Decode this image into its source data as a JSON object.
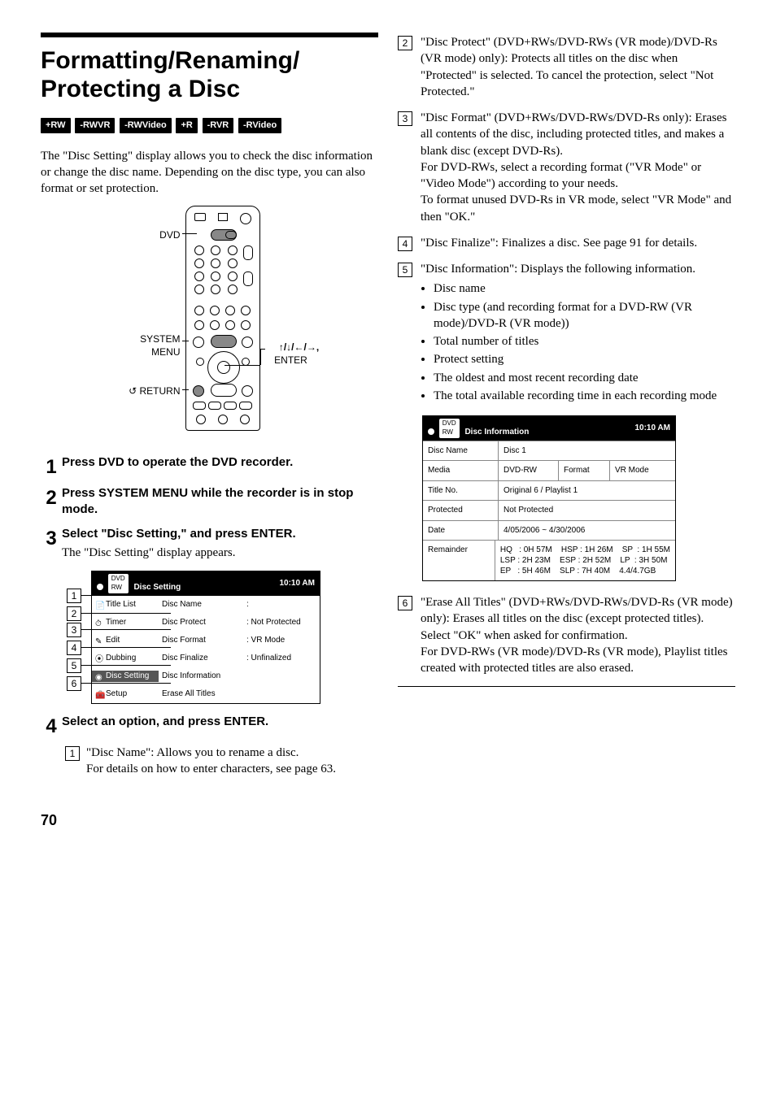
{
  "page_number": "70",
  "heading": "Formatting/Renaming/\nProtecting a Disc",
  "disc_tags": [
    "+RW",
    "-RWVR",
    "-RWVideo",
    "+R",
    "-RVR",
    "-RVideo"
  ],
  "intro": "The \"Disc Setting\" display allows you to check the disc information or change the disc name. Depending on the disc type, you can also format or set protection.",
  "remote": {
    "dvd": "DVD",
    "system_menu": "SYSTEM\nMENU",
    "return": "RETURN",
    "enter": "ENTER",
    "arrows": "↑/↓/←/→,"
  },
  "steps": {
    "s1": "Press DVD to operate the DVD recorder.",
    "s2": "Press SYSTEM MENU while the recorder is in stop mode.",
    "s3": "Select \"Disc Setting,\" and press ENTER.",
    "s3_sub": "The \"Disc Setting\" display appears.",
    "s4": "Select an option, and press ENTER."
  },
  "disc_setting_panel": {
    "title": "Disc Setting",
    "time": "10:10 AM",
    "sidebar": [
      "Title List",
      "Timer",
      "Edit",
      "Dubbing",
      "Disc Setting",
      "Setup"
    ],
    "rows": [
      {
        "name": "Disc Name",
        "val": ":"
      },
      {
        "name": "Disc Protect",
        "val": ":  Not Protected"
      },
      {
        "name": "Disc Format",
        "val": ":  VR Mode"
      },
      {
        "name": "Disc Finalize",
        "val": ":  Unfinalized"
      },
      {
        "name": "Disc Information",
        "val": ""
      },
      {
        "name": "Erase All Titles",
        "val": ""
      }
    ]
  },
  "opt1": {
    "lead": "\"Disc Name\": Allows you to rename a disc.",
    "tail": "For details on how to enter characters, see page 63."
  },
  "opt2": "\"Disc Protect\" (DVD+RWs/DVD-RWs (VR mode)/DVD-Rs (VR mode) only): Protects all titles on the disc when \"Protected\" is selected. To cancel the protection, select \"Not Protected.\"",
  "opt3": {
    "p1": "\"Disc Format\" (DVD+RWs/DVD-RWs/DVD-Rs only): Erases all contents of the disc, including protected titles, and makes a blank disc (except DVD-Rs).",
    "p2": "For DVD-RWs, select a recording format (\"VR Mode\" or \"Video Mode\") according to your needs.",
    "p3": "To format unused DVD-Rs in VR mode, select \"VR Mode\" and then \"OK.\""
  },
  "opt4": "\"Disc Finalize\": Finalizes a disc. See page 91 for details.",
  "opt5": {
    "lead": "\"Disc Information\": Displays the following information.",
    "bullets": [
      "Disc name",
      "Disc type (and recording format for a DVD-RW (VR mode)/DVD-R (VR mode))",
      "Total number of titles",
      "Protect setting",
      "The oldest and most recent recording date",
      "The total available recording time in each recording mode"
    ]
  },
  "disc_info_panel": {
    "title": "Disc Information",
    "time": "10:10 AM",
    "rows": {
      "disc_name_l": "Disc Name",
      "disc_name_v": "Disc 1",
      "media_l": "Media",
      "media_a": "DVD-RW",
      "media_b": "Format",
      "media_c": "VR Mode",
      "titleno_l": "Title No.",
      "titleno_v": "Original 6 / Playlist 1",
      "protected_l": "Protected",
      "protected_v": "Not Protected",
      "date_l": "Date",
      "date_v": "4/05/2006 ~ 4/30/2006",
      "remainder_l": "Remainder",
      "remainder_v": "HQ   : 0H 57M    HSP : 1H 26M    SP  : 1H 55M\nLSP : 2H 23M    ESP : 2H 52M    LP  : 3H 50M\nEP   : 5H 46M    SLP : 7H 40M    4.4/4.7GB"
    }
  },
  "opt6": {
    "p1": "\"Erase All Titles\" (DVD+RWs/DVD-RWs/DVD-Rs (VR mode) only): Erases all titles on the disc (except protected titles). Select \"OK\" when asked for confirmation.",
    "p2": "For DVD-RWs (VR mode)/DVD-Rs (VR mode), Playlist titles created with protected titles are also erased."
  }
}
